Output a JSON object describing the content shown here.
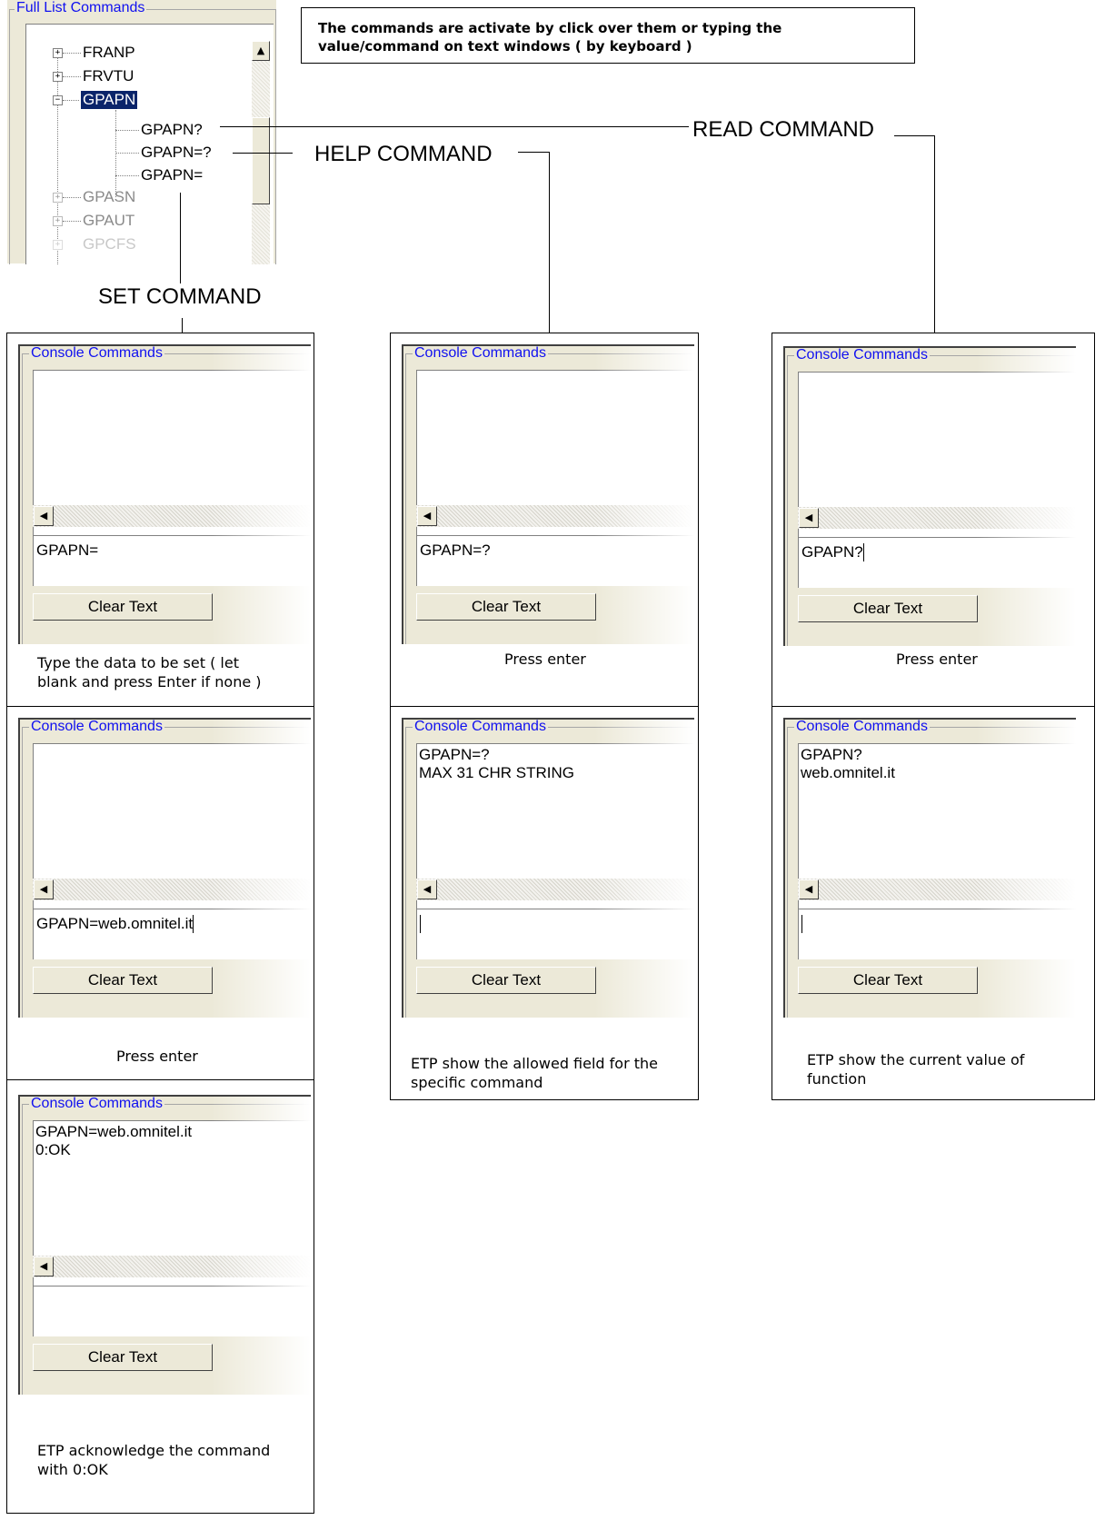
{
  "tree_panel": {
    "title": "Full List Commands",
    "items": [
      {
        "label": "FRANP",
        "state": "collapsed"
      },
      {
        "label": "FRVTU",
        "state": "collapsed"
      },
      {
        "label": "GPAPN",
        "state": "expanded",
        "selected": true
      },
      {
        "label": "GPAPN?"
      },
      {
        "label": "GPAPN=?"
      },
      {
        "label": "GPAPN="
      },
      {
        "label": "GPASN",
        "state": "collapsed"
      },
      {
        "label": "GPAUT",
        "state": "collapsed"
      },
      {
        "label": "GPCFS",
        "state": "collapsed"
      }
    ]
  },
  "note": {
    "line1": "The commands are activate by click over them or typing the",
    "line2": "value/command on text windows ( by keyboard )"
  },
  "labels": {
    "read": "READ COMMAND",
    "help": "HELP COMMAND",
    "set": "SET COMMAND"
  },
  "console_title": "Console Commands",
  "clear_label": "Clear Text",
  "steps": {
    "set1": {
      "output": "",
      "input": "GPAPN=",
      "caption1": "Type  the data to be set ( let",
      "caption2": "blank and press Enter if none )"
    },
    "help1": {
      "output": "",
      "input": "GPAPN=?",
      "caption1": "Press enter"
    },
    "read1": {
      "output": "",
      "input": "GPAPN?",
      "caption1": "Press enter"
    },
    "set2": {
      "output": "",
      "input": "GPAPN=web.omnitel.it",
      "caption1": "Press enter"
    },
    "help2": {
      "output1": "GPAPN=?",
      "output2": "MAX 31 CHR STRING",
      "input": "",
      "caption1": "ETP show the allowed field for the",
      "caption2": "specific command"
    },
    "read2": {
      "output1": "GPAPN?",
      "output2": "web.omnitel.it",
      "input": "",
      "caption1": "ETP show the current value of",
      "caption2": "function"
    },
    "set3": {
      "output1": "GPAPN=web.omnitel.it",
      "output2": "0:OK",
      "input": "",
      "caption1": "ETP acknowledge the command",
      "caption2": "with 0:OK"
    }
  }
}
